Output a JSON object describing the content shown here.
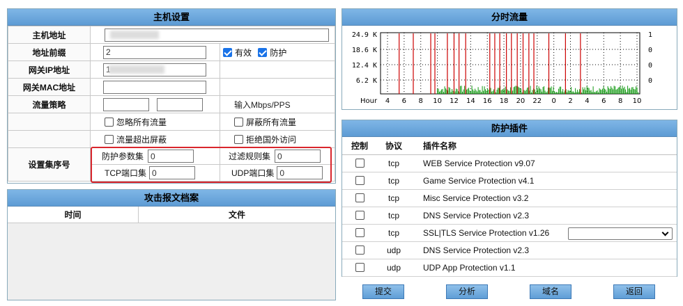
{
  "host_settings": {
    "title": "主机设置",
    "rows": {
      "host_addr_label": "主机地址",
      "prefix_label": "地址前缀",
      "gateway_ip_label": "网关IP地址",
      "gateway_mac_label": "网关MAC地址",
      "traffic_policy_label": "流量策略",
      "set_seq_label": "设置集序号"
    },
    "values": {
      "host_addr": "",
      "prefix": "2",
      "gateway_ip": "1",
      "gateway_mac": "",
      "policy_in": "",
      "policy_out": ""
    },
    "checkboxes": {
      "valid": "有效",
      "protect": "防护",
      "ignore_all": "忽略所有流量",
      "block_all": "屏蔽所有流量",
      "over_block": "流量超出屏蔽",
      "reject_foreign": "拒绝国外访问"
    },
    "unit_hint": "输入Mbps/PPS",
    "sets": {
      "protect_param_label": "防护参数集",
      "protect_param": "0",
      "filter_rule_label": "过滤规则集",
      "filter_rule": "0",
      "tcp_port_label": "TCP端口集",
      "tcp_port": "0",
      "udp_port_label": "UDP端口集",
      "udp_port": "0"
    }
  },
  "attack_archive": {
    "title": "攻击报文档案",
    "col_time": "时间",
    "col_file": "文件"
  },
  "traffic": {
    "title": "分时流量"
  },
  "chart_data": {
    "type": "bar",
    "ylabels_left": [
      "24.9 K",
      "18.6 K",
      "12.4 K",
      "6.2 K"
    ],
    "ylabels_right": [
      "1",
      "0",
      "0",
      "0"
    ],
    "x_title": "Hour",
    "x_ticks": [
      "4",
      "6",
      "8",
      "10",
      "12",
      "14",
      "16",
      "18",
      "20",
      "22",
      "0",
      "2",
      "4",
      "6",
      "8",
      "10"
    ],
    "red_spikes_hours": [
      11.2,
      12.0,
      12.6,
      13.4,
      16.3,
      16.9,
      17.5,
      18.3,
      18.9,
      19.6,
      20.3,
      21.0,
      21.6,
      23.4,
      1.4,
      3.2,
      5.4,
      7.1,
      9.2,
      9.7
    ],
    "green_baseline": "low",
    "colors": {
      "spike": "#cc0000",
      "base": "#119911"
    }
  },
  "plugins": {
    "title": "防护插件",
    "col_control": "控制",
    "col_proto": "协议",
    "col_name": "插件名称",
    "rows": [
      {
        "proto": "tcp",
        "name": "WEB Service Protection v9.07"
      },
      {
        "proto": "tcp",
        "name": "Game Service Protection v4.1"
      },
      {
        "proto": "tcp",
        "name": "Misc Service Protection v3.2"
      },
      {
        "proto": "tcp",
        "name": "DNS Service Protection v2.3"
      },
      {
        "proto": "tcp",
        "name": "SSL|TLS Service Protection v1.26"
      },
      {
        "proto": "udp",
        "name": "DNS Service Protection v2.3"
      },
      {
        "proto": "udp",
        "name": "UDP App Protection v1.1"
      }
    ]
  },
  "buttons": {
    "submit": "提交",
    "analyze": "分析",
    "domain": "域名",
    "back": "返回"
  }
}
